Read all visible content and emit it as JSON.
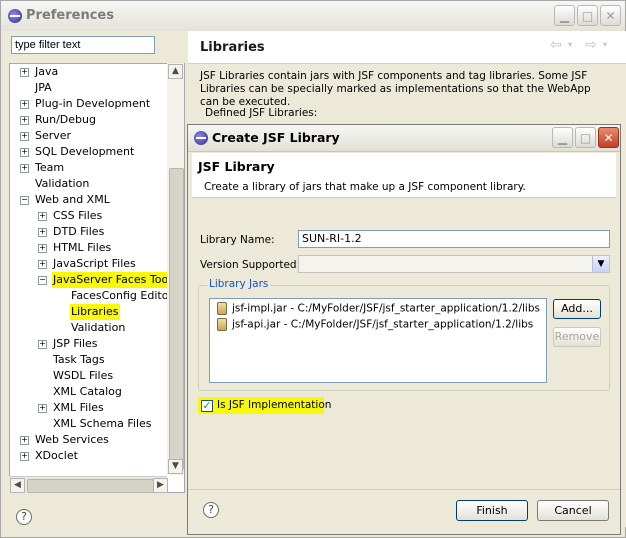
{
  "window": {
    "title": "Preferences"
  },
  "filter": {
    "placeholder": "type filter text"
  },
  "tree": [
    {
      "label": "Java",
      "expander": "+",
      "level": 0,
      "highlight": false
    },
    {
      "label": "JPA",
      "expander": "",
      "level": 0,
      "highlight": false
    },
    {
      "label": "Plug-in Development",
      "expander": "+",
      "level": 0,
      "highlight": false
    },
    {
      "label": "Run/Debug",
      "expander": "+",
      "level": 0,
      "highlight": false
    },
    {
      "label": "Server",
      "expander": "+",
      "level": 0,
      "highlight": false
    },
    {
      "label": "SQL Development",
      "expander": "+",
      "level": 0,
      "highlight": false
    },
    {
      "label": "Team",
      "expander": "+",
      "level": 0,
      "highlight": false
    },
    {
      "label": "Validation",
      "expander": "",
      "level": 0,
      "highlight": false
    },
    {
      "label": "Web and XML",
      "expander": "-",
      "level": 0,
      "highlight": false
    },
    {
      "label": "CSS Files",
      "expander": "+",
      "level": 1,
      "highlight": false
    },
    {
      "label": "DTD Files",
      "expander": "+",
      "level": 1,
      "highlight": false
    },
    {
      "label": "HTML Files",
      "expander": "+",
      "level": 1,
      "highlight": false
    },
    {
      "label": "JavaScript Files",
      "expander": "+",
      "level": 1,
      "highlight": false
    },
    {
      "label": "JavaServer Faces Tools",
      "expander": "-",
      "level": 1,
      "highlight": true
    },
    {
      "label": "FacesConfig Editor",
      "expander": "",
      "level": 2,
      "highlight": false
    },
    {
      "label": "Libraries",
      "expander": "",
      "level": 2,
      "highlight": true
    },
    {
      "label": "Validation",
      "expander": "",
      "level": 2,
      "highlight": false
    },
    {
      "label": "JSP Files",
      "expander": "+",
      "level": 1,
      "highlight": false
    },
    {
      "label": "Task Tags",
      "expander": "",
      "level": 1,
      "highlight": false
    },
    {
      "label": "WSDL Files",
      "expander": "",
      "level": 1,
      "highlight": false
    },
    {
      "label": "XML Catalog",
      "expander": "",
      "level": 1,
      "highlight": false
    },
    {
      "label": "XML Files",
      "expander": "+",
      "level": 1,
      "highlight": false
    },
    {
      "label": "XML Schema Files",
      "expander": "",
      "level": 1,
      "highlight": false
    },
    {
      "label": "Web Services",
      "expander": "+",
      "level": 0,
      "highlight": false
    },
    {
      "label": "XDoclet",
      "expander": "+",
      "level": 0,
      "highlight": false
    }
  ],
  "page": {
    "title": "Libraries",
    "description": "JSF Libraries contain jars with JSF components and tag libraries.   Some JSF Libraries can be specially marked as implementations so that the WebApp can be executed.",
    "defined_label": "Defined JSF Libraries:"
  },
  "dialog": {
    "title": "Create JSF Library",
    "banner_title": "JSF Library",
    "banner_desc": "Create a library of jars that make up a JSF component library.",
    "library_name_label": "Library Name:",
    "library_name_value": "SUN-RI-1.2",
    "version_label": "Version Supported:",
    "version_value": "",
    "jars_group_label": "Library Jars",
    "jars": [
      "jsf-impl.jar - C:/MyFolder/JSF/jsf_starter_application/1.2/libs",
      "jsf-api.jar - C:/MyFolder/JSF/jsf_starter_application/1.2/libs"
    ],
    "add_button": "Add...",
    "remove_button": "Remove",
    "is_impl_label": "Is JSF Implementation",
    "is_impl_checked": true,
    "finish_button": "Finish",
    "cancel_button": "Cancel"
  }
}
